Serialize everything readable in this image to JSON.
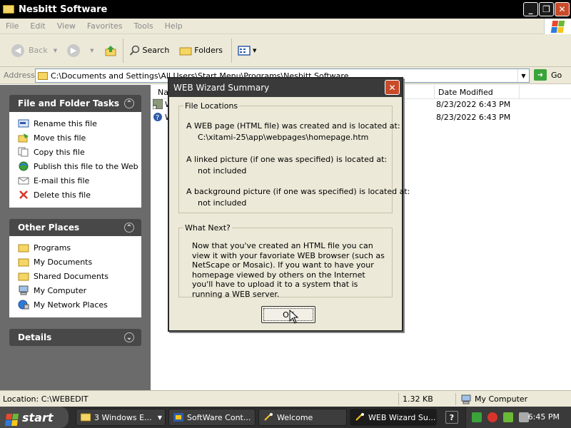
{
  "window": {
    "title": "Nesbitt Software",
    "buttons": {
      "minimize": "_",
      "maximize": "❐",
      "close": "✕"
    }
  },
  "menubar": {
    "items": [
      "File",
      "Edit",
      "View",
      "Favorites",
      "Tools",
      "Help"
    ]
  },
  "toolbar": {
    "back_label": "Back",
    "search_label": "Search",
    "folders_label": "Folders"
  },
  "address": {
    "label": "Address",
    "value": "C:\\Documents and Settings\\All Users\\Start Menu\\Programs\\Nesbitt Software",
    "go_label": "Go"
  },
  "sidebar": {
    "file_tasks": {
      "title": "File and Folder Tasks",
      "items": [
        {
          "label": "Rename this file",
          "icon": "rename-icon"
        },
        {
          "label": "Move this file",
          "icon": "move-icon"
        },
        {
          "label": "Copy this file",
          "icon": "copy-icon"
        },
        {
          "label": "Publish this file to the Web",
          "icon": "publish-web-icon"
        },
        {
          "label": "E-mail this file",
          "icon": "email-icon"
        },
        {
          "label": "Delete this file",
          "icon": "delete-icon"
        }
      ]
    },
    "other_places": {
      "title": "Other Places",
      "items": [
        {
          "label": "Programs",
          "icon": "folder-icon"
        },
        {
          "label": "My Documents",
          "icon": "folder-icon"
        },
        {
          "label": "Shared Documents",
          "icon": "folder-icon"
        },
        {
          "label": "My Computer",
          "icon": "computer-icon"
        },
        {
          "label": "My Network Places",
          "icon": "network-icon"
        }
      ]
    },
    "details": {
      "title": "Details"
    }
  },
  "filelist": {
    "columns": {
      "name": "Na",
      "date_modified": "Date Modified"
    },
    "rows": [
      {
        "name": "W",
        "date": "8/23/2022 6:43 PM",
        "icon": "shortcut-icon"
      },
      {
        "name": "W",
        "date": "8/23/2022 6:43 PM",
        "icon": "help-shortcut-icon"
      }
    ]
  },
  "dialog": {
    "title": "WEB Wizard Summary",
    "file_locations": {
      "legend": "File Locations",
      "line1": "A WEB page (HTML file) was created and is located at:",
      "path1": "C:\\xitami-25\\app\\webpages\\homepage.htm",
      "line2": "A linked picture (if one was specified) is located at:",
      "path2": "not included",
      "line3": "A background picture (if one was specified) is located at:",
      "path3": "not included"
    },
    "what_next": {
      "legend": "What Next?",
      "text": "Now that you've created an HTML file you can view it with your favoriate WEB browser (such as NetScape or Mosaic). If you want to have your homepage viewed by others on the Internet you'll have to upload it to a system that is running a WEB server."
    },
    "ok_label": "OK"
  },
  "statusbar": {
    "location": "Location: C:\\WEBEDIT",
    "size": "1.32 KB",
    "zone": "My Computer"
  },
  "taskbar": {
    "start_label": "start",
    "tasks": [
      {
        "label": "3 Windows E...",
        "icon": "folder-icon",
        "active": false
      },
      {
        "label": "SoftWare Cont...",
        "icon": "app-icon",
        "active": false
      },
      {
        "label": "Welcome",
        "icon": "wizard-icon",
        "active": false
      },
      {
        "label": "WEB Wizard Su...",
        "icon": "wizard-icon",
        "active": true
      }
    ],
    "clock": "6:45 PM"
  }
}
